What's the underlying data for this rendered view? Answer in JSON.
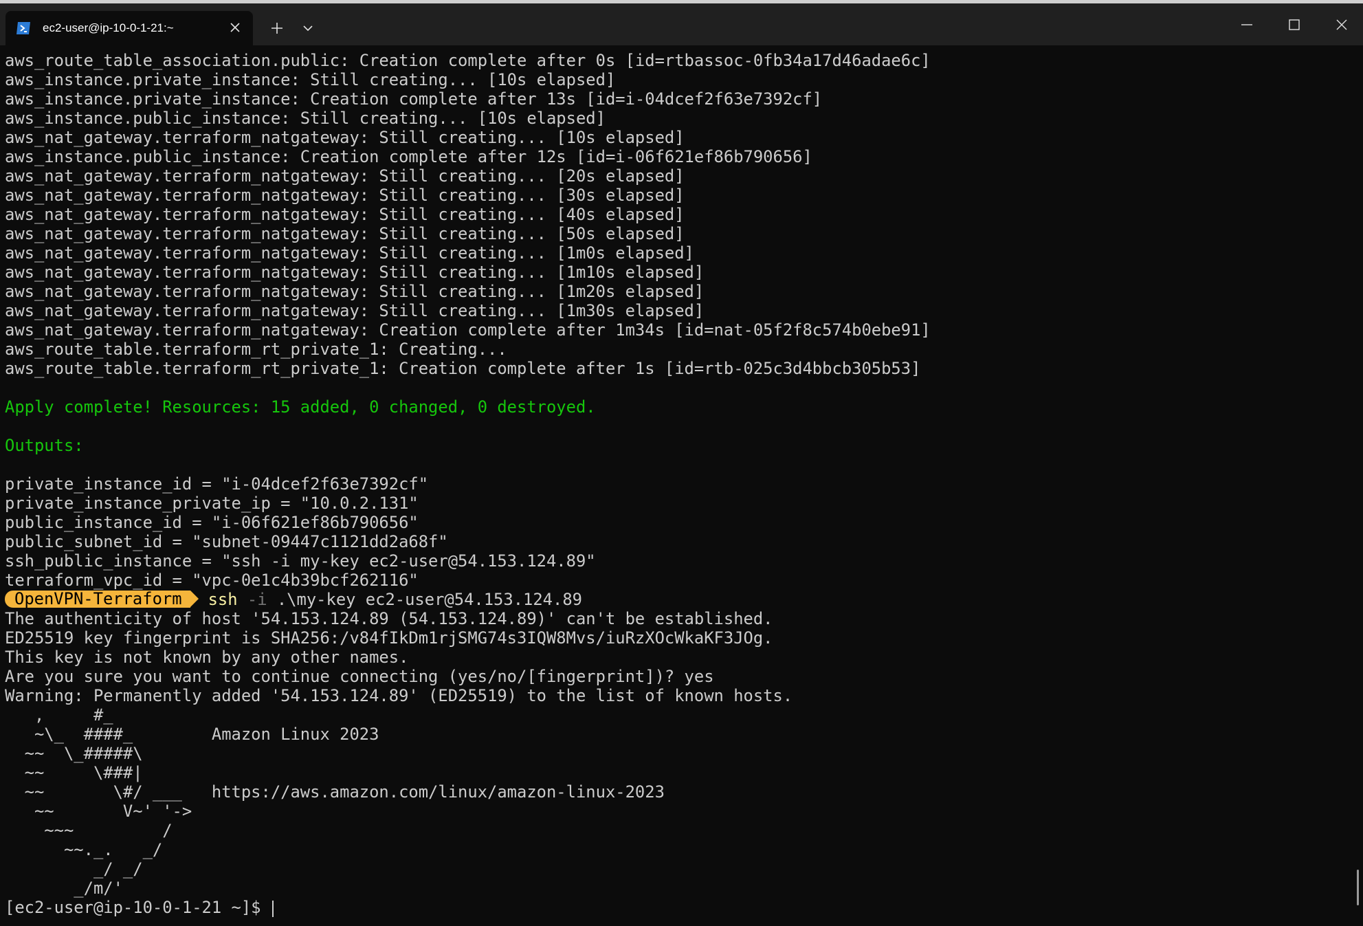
{
  "window": {
    "tab_title": "ec2-user@ip-10-0-1-21:~",
    "icons": {
      "tab": "powershell-icon",
      "close_tab": "close-icon",
      "new_tab": "plus-icon",
      "dropdown": "chevron-down-icon",
      "minimize": "minimize-icon",
      "maximize": "maximize-icon",
      "close_window": "close-icon"
    }
  },
  "colors": {
    "background": "#0c0c0c",
    "text": "#cccccc",
    "success_green": "#16c60c",
    "prompt_bg": "#f5b53b"
  },
  "terminal": {
    "log_lines": [
      "aws_route_table_association.public: Creation complete after 0s [id=rtbassoc-0fb34a17d46adae6c]",
      "aws_instance.private_instance: Still creating... [10s elapsed]",
      "aws_instance.private_instance: Creation complete after 13s [id=i-04dcef2f63e7392cf]",
      "aws_instance.public_instance: Still creating... [10s elapsed]",
      "aws_nat_gateway.terraform_natgateway: Still creating... [10s elapsed]",
      "aws_instance.public_instance: Creation complete after 12s [id=i-06f621ef86b790656]",
      "aws_nat_gateway.terraform_natgateway: Still creating... [20s elapsed]",
      "aws_nat_gateway.terraform_natgateway: Still creating... [30s elapsed]",
      "aws_nat_gateway.terraform_natgateway: Still creating... [40s elapsed]",
      "aws_nat_gateway.terraform_natgateway: Still creating... [50s elapsed]",
      "aws_nat_gateway.terraform_natgateway: Still creating... [1m0s elapsed]",
      "aws_nat_gateway.terraform_natgateway: Still creating... [1m10s elapsed]",
      "aws_nat_gateway.terraform_natgateway: Still creating... [1m20s elapsed]",
      "aws_nat_gateway.terraform_natgateway: Still creating... [1m30s elapsed]",
      "aws_nat_gateway.terraform_natgateway: Creation complete after 1m34s [id=nat-05f2f8c574b0ebe91]",
      "aws_route_table.terraform_rt_private_1: Creating...",
      "aws_route_table.terraform_rt_private_1: Creation complete after 1s [id=rtb-025c3d4bbcb305b53]"
    ],
    "apply_summary": "Apply complete! Resources: 15 added, 0 changed, 0 destroyed.",
    "outputs_header": "Outputs:",
    "outputs": [
      "private_instance_id = \"i-04dcef2f63e7392cf\"",
      "private_instance_private_ip = \"10.0.2.131\"",
      "public_instance_id = \"i-06f621ef86b790656\"",
      "public_subnet_id = \"subnet-09447c1121dd2a68f\"",
      "ssh_public_instance = \"ssh -i my-key ec2-user@54.153.124.89\"",
      "terraform_vpc_id = \"vpc-0e1c4b39bcf262116\""
    ],
    "prompt_label": "OpenVPN-Terraform",
    "command_name": "ssh",
    "command_flag": "-i",
    "command_args": ".\\my-key ec2-user@54.153.124.89",
    "ssh_lines": [
      "The authenticity of host '54.153.124.89 (54.153.124.89)' can't be established.",
      "ED25519 key fingerprint is SHA256:/v84fIkDm1rjSMG74s3IQW8Mvs/iuRzXOcWkaKF3JOg.",
      "This key is not known by any other names.",
      "Are you sure you want to continue connecting (yes/no/[fingerprint])? yes",
      "Warning: Permanently added '54.153.124.89' (ED25519) to the list of known hosts."
    ],
    "banner_lines": [
      "   ,     #_",
      "   ~\\_  ####_        Amazon Linux 2023",
      "  ~~  \\_#####\\",
      "  ~~     \\###|",
      "  ~~       \\#/ ___   https://aws.amazon.com/linux/amazon-linux-2023",
      "   ~~       V~' '->",
      "    ~~~         /",
      "      ~~._.   _/",
      "         _/ _/",
      "       _/m/'"
    ],
    "final_prompt": "[ec2-user@ip-10-0-1-21 ~]$ "
  }
}
